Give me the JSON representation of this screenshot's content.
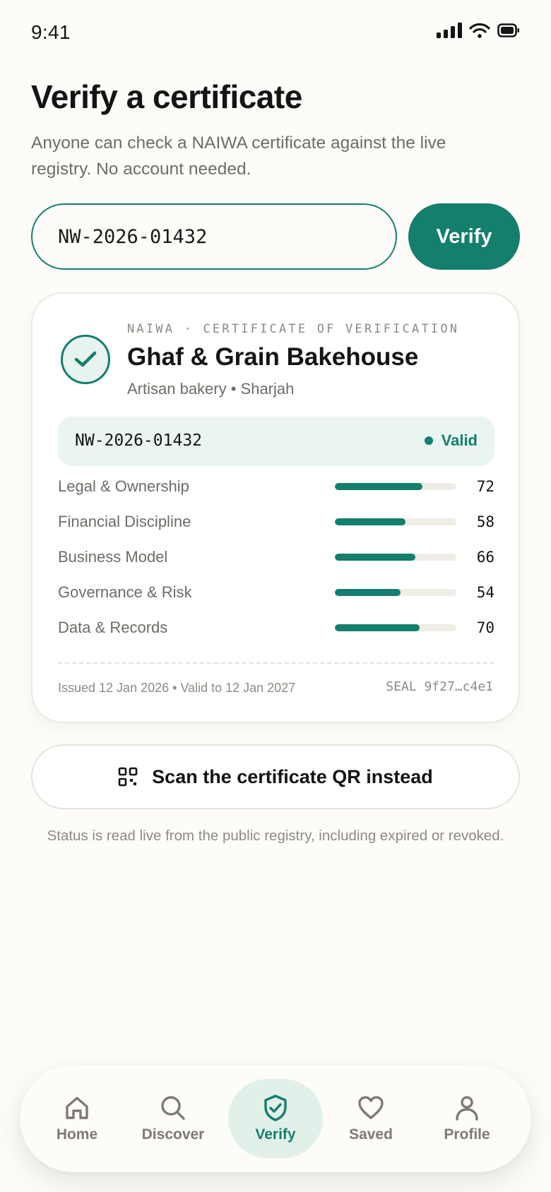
{
  "status_bar": {
    "time": "9:41"
  },
  "page": {
    "title": "Verify a certificate",
    "subtitle": "Anyone can check a NAIWA certificate against the live registry. No account needed."
  },
  "search": {
    "value": "NW-2026-01432",
    "verify_label": "Verify"
  },
  "certificate": {
    "eyebrow": "NAIWA · CERTIFICATE OF VERIFICATION",
    "business_name": "Ghaf & Grain Bakehouse",
    "business_meta": "Artisan bakery • Sharjah",
    "id": "NW-2026-01432",
    "status": "Valid",
    "scores": [
      {
        "label": "Legal & Ownership",
        "value": 72
      },
      {
        "label": "Financial Discipline",
        "value": 58
      },
      {
        "label": "Business Model",
        "value": 66
      },
      {
        "label": "Governance & Risk",
        "value": 54
      },
      {
        "label": "Data & Records",
        "value": 70
      }
    ],
    "issued": "Issued 12 Jan 2026 • Valid to 12 Jan 2027",
    "seal": "SEAL 9f27…c4e1"
  },
  "scan": {
    "label": "Scan the certificate QR instead"
  },
  "footnote": "Status is read live from the public registry, including expired or revoked.",
  "tabs": [
    {
      "label": "Home",
      "icon": "home-icon",
      "active": false
    },
    {
      "label": "Discover",
      "icon": "search-icon",
      "active": false
    },
    {
      "label": "Verify",
      "icon": "shield-check-icon",
      "active": true
    },
    {
      "label": "Saved",
      "icon": "heart-icon",
      "active": false
    },
    {
      "label": "Profile",
      "icon": "user-icon",
      "active": false
    }
  ],
  "colors": {
    "accent": "#137f6c",
    "background": "#fdfcf8",
    "muted_text": "#6e6c66"
  }
}
